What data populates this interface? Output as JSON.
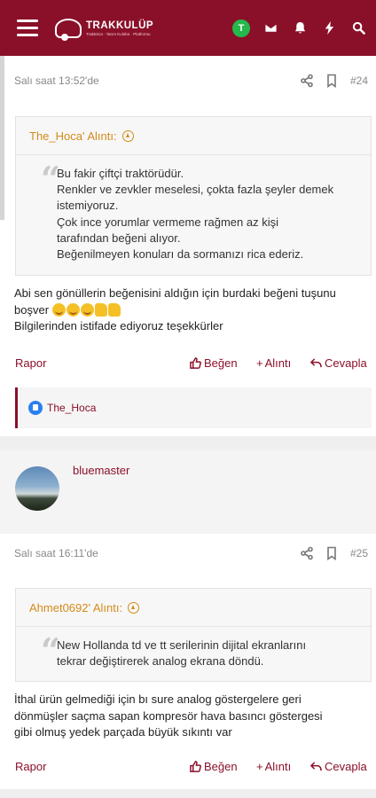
{
  "header": {
    "logo_name": "TRAKKULÜP",
    "logo_sub": "Traktörcü · Tarım Kulübü · Platformu",
    "user_initial": "T",
    "icons": [
      "menu-icon",
      "envelope-icon",
      "bell-icon",
      "bolt-icon",
      "search-icon"
    ]
  },
  "posts": [
    {
      "time": "Salı saat 13:52'de",
      "number": "#24",
      "quote": {
        "author_line": "The_Hoca' Alıntı:",
        "lines": [
          "Bu fakir çiftçi traktörüdür.",
          "Renkler ve zevkler meselesi, çokta fazla şeyler demek",
          "istemiyoruz.",
          "Çok ince yorumlar vermeme rağmen az kişi",
          "tarafından beğeni alıyor.",
          "Beğenilmeyen konuları da sormanızı rica ederiz."
        ]
      },
      "text_line1": "Abi sen gönüllerin beğenisini aldığın için burdaki beğeni tuşunu",
      "text_line2": "boşver",
      "text_line3": "Bilgilerinden istifade ediyoruz teşekkürler",
      "actions": {
        "report": "Rapor",
        "like": "Beğen",
        "quote": "Alıntı",
        "reply": "Cevapla"
      },
      "liked_by": "The_Hoca"
    },
    {
      "user": "bluemaster",
      "time": "Salı saat 16:11'de",
      "number": "#25",
      "quote": {
        "author_line": "Ahmet0692' Alıntı:",
        "lines": [
          "New Hollanda td ve tt serilerinin dijital ekranlarını",
          "tekrar değiştirerek analog ekrana döndü."
        ]
      },
      "text_lines": [
        "İthal ürün gelmediği için bı sure analog göstergelere geri",
        "dönmüşler saçma sapan kompresör hava basıncı göstergesi",
        "gibi olmuş yedek parçada büyük sıkıntı var"
      ],
      "actions": {
        "report": "Rapor",
        "like": "Beğen",
        "quote": "Alıntı",
        "reply": "Cevapla"
      }
    }
  ],
  "colors": {
    "brand": "#8a1029",
    "quote_accent": "#d58b1a",
    "online": "#25b84a",
    "like_blue": "#2a7ff0"
  }
}
